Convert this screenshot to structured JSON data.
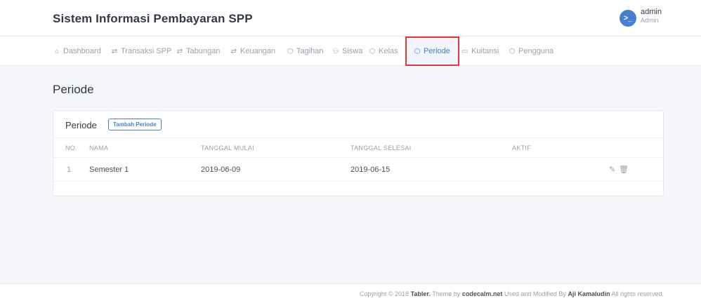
{
  "header": {
    "brand": "Sistem Informasi Pembayaran SPP",
    "user": {
      "name": "admin",
      "role": "Admin",
      "avatar_glyph": ">_"
    }
  },
  "nav": {
    "items": [
      {
        "label": "Dashboard",
        "icon": "home-icon"
      },
      {
        "label": "Transaksi SPP",
        "icon": "repeat-icon"
      },
      {
        "label": "Tabungan",
        "icon": "repeat-icon"
      },
      {
        "label": "Keuangan",
        "icon": "repeat-icon"
      },
      {
        "label": "Tagihan",
        "icon": "box-icon"
      },
      {
        "label": "Siswa",
        "icon": "users-icon"
      },
      {
        "label": "Kelas",
        "icon": "box-icon"
      },
      {
        "label": "Periode",
        "icon": "box-icon",
        "active": true
      },
      {
        "label": "Kuitansi",
        "icon": "folder-icon"
      },
      {
        "label": "Pengguna",
        "icon": "box-icon"
      }
    ],
    "active_color": "#467fcf",
    "highlight_color": "#e53935"
  },
  "page": {
    "title": "Periode"
  },
  "card": {
    "title": "Periode",
    "add_button": "Tambah Periode",
    "columns": [
      "NO.",
      "NAMA",
      "TANGGAL MULAI",
      "TANGGAL SELESAI",
      "AKTIF"
    ],
    "rows": [
      {
        "no": "1",
        "nama": "Semester 1",
        "mulai": "2019-06-09",
        "selesai": "2019-06-15",
        "aktif": ""
      }
    ],
    "actions": [
      "edit-icon",
      "trash-icon"
    ]
  },
  "footer": {
    "prefix": "Copyright © 2018",
    "tabler": "Tabler.",
    "theme_by": "Theme by",
    "codecalm": "codecalm.net",
    "used": "Used and Modified By",
    "author": "Aji Kamaludin",
    "suffix": "All rights reserved."
  }
}
